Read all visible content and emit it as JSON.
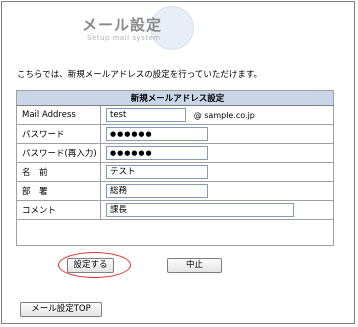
{
  "header": {
    "title": "メール設定",
    "subtitle": "Setup mail system"
  },
  "intro_text": "こちらでは、新規メールアドレスの設定を行っていただけます。",
  "form": {
    "heading": "新規メールアドレス設定",
    "rows": [
      {
        "label": "Mail Address",
        "value": "test",
        "suffix": "@ sample.co.jp"
      },
      {
        "label": "パスワード",
        "value": "●●●●●●"
      },
      {
        "label": "パスワード(再入力)",
        "value": "●●●●●●"
      },
      {
        "label": "名　前",
        "value": "テスト"
      },
      {
        "label": "部　署",
        "value": "総務"
      },
      {
        "label": "コメント",
        "value": "課長"
      }
    ]
  },
  "buttons": {
    "submit": "設定する",
    "cancel": "中止",
    "top": "メール設定TOP"
  },
  "colors": {
    "table_header": "#c8d6e8",
    "highlight": "#e03030"
  }
}
